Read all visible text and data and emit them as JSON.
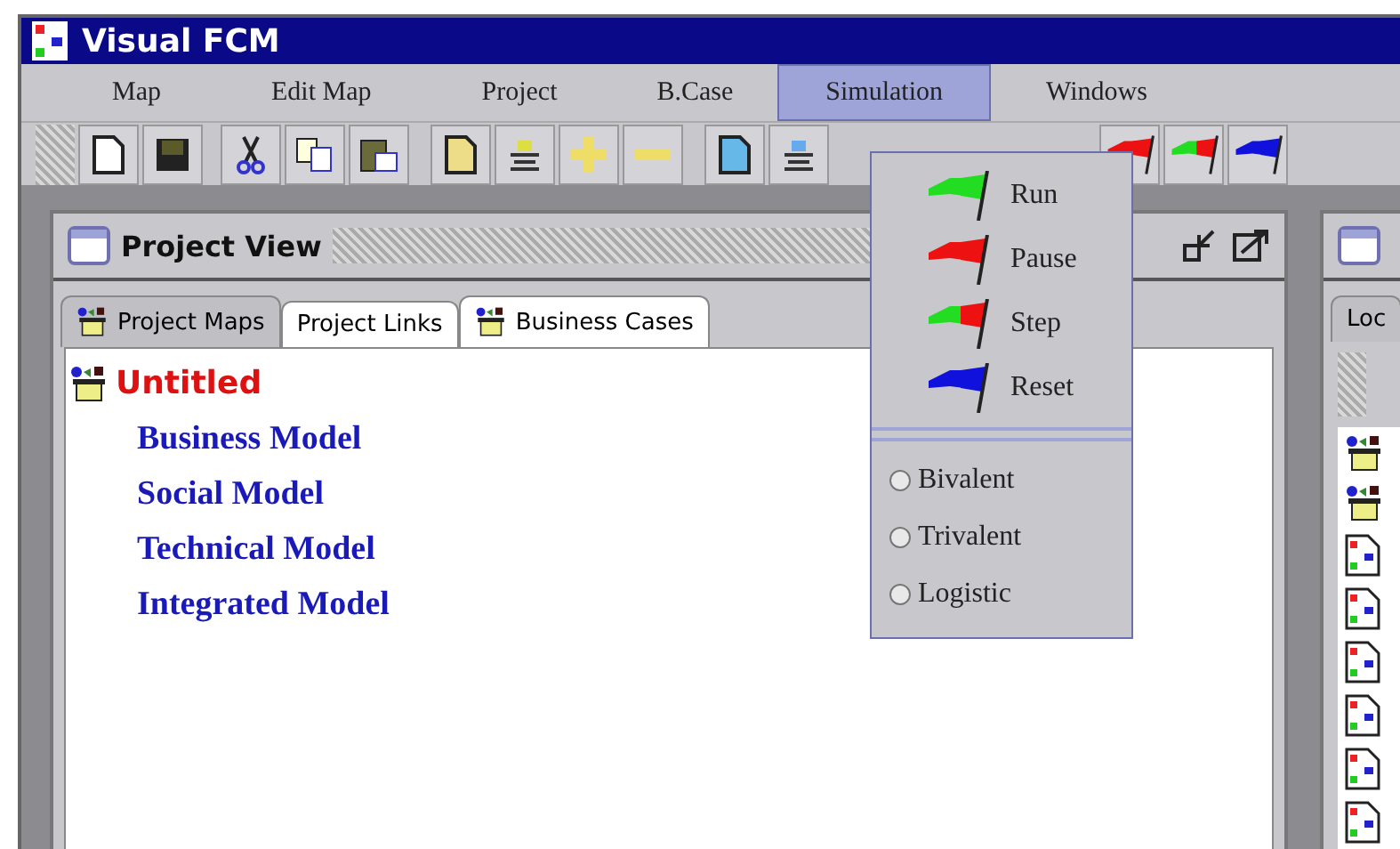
{
  "window": {
    "title": "Visual FCM"
  },
  "menu_bar": [
    {
      "label": "Map",
      "selected": false
    },
    {
      "label": "Edit Map",
      "selected": false
    },
    {
      "label": "Project",
      "selected": false
    },
    {
      "label": "B.Case",
      "selected": false
    },
    {
      "label": "Simulation",
      "selected": true
    },
    {
      "label": "Windows",
      "selected": false
    }
  ],
  "simulation_menu": [
    {
      "kind": "run",
      "label": "Run"
    },
    {
      "kind": "pause",
      "label": "Pause"
    },
    {
      "kind": "step",
      "label": "Step"
    },
    {
      "kind": "reset",
      "label": "Reset"
    },
    {
      "kind": "separator"
    },
    {
      "kind": "radio",
      "label": "Bivalent",
      "selected": false
    },
    {
      "kind": "radio",
      "label": "Trivalent",
      "selected": false
    },
    {
      "kind": "radio",
      "label": "Logistic",
      "selected": false
    }
  ],
  "project_view": {
    "title": "Project View",
    "tabs": [
      {
        "kind": "project",
        "label": "Project Maps",
        "selected": true
      },
      {
        "kind": "plain",
        "label": "Project Links",
        "selected": false
      },
      {
        "kind": "project",
        "label": "Business Cases",
        "selected": false
      }
    ],
    "tree": [
      {
        "label": "Untitled",
        "color": "#dd1111",
        "children": [
          {
            "label": "Business Model",
            "color": "#1a1ab8"
          },
          {
            "label": "Social Model",
            "color": "#1a1ab8"
          },
          {
            "label": "Technical Model",
            "color": "#1a1ab8"
          },
          {
            "label": "Integrated Model",
            "color": "#1a1ab8"
          }
        ]
      }
    ]
  },
  "side_panel": {
    "tabs": [
      {
        "label": "Loc",
        "selected": true
      }
    ],
    "items": [
      {
        "kind": "project"
      },
      {
        "kind": "project"
      },
      {
        "kind": "map"
      },
      {
        "kind": "map"
      },
      {
        "kind": "map"
      },
      {
        "kind": "map"
      },
      {
        "kind": "map"
      },
      {
        "kind": "map"
      }
    ]
  }
}
